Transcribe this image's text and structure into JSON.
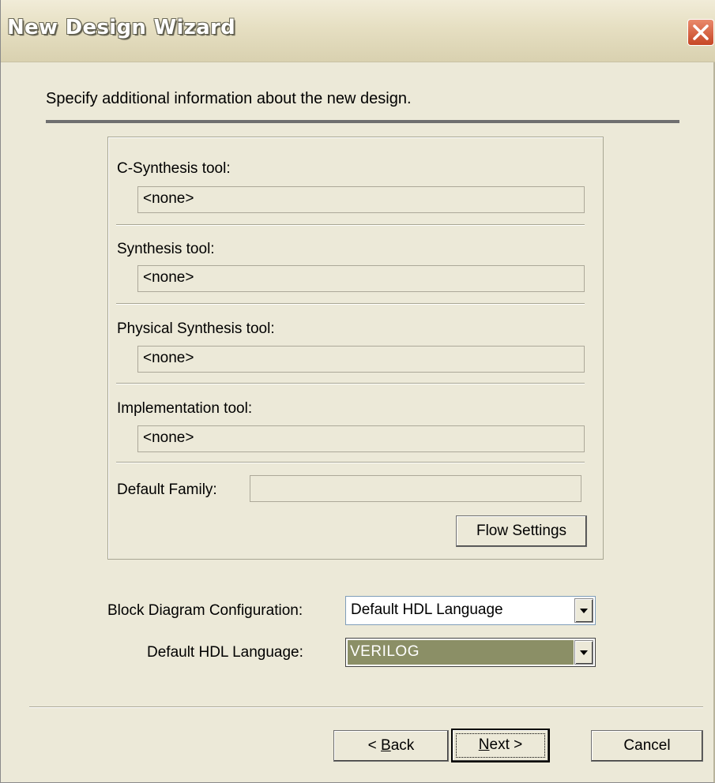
{
  "window": {
    "title": "New Design Wizard"
  },
  "instruction": "Specify additional information about the new design.",
  "tools": {
    "c_synthesis_label": "C-Synthesis tool:",
    "c_synthesis_value": "<none>",
    "synthesis_label": "Synthesis tool:",
    "synthesis_value": "<none>",
    "physical_synthesis_label": "Physical Synthesis tool:",
    "physical_synthesis_value": "<none>",
    "implementation_label": "Implementation tool:",
    "implementation_value": "<none>",
    "default_family_label": "Default Family:",
    "default_family_value": "",
    "flow_settings_label": "Flow Settings"
  },
  "block_diagram": {
    "label": "Block Diagram Configuration:",
    "selected": "Default HDL Language"
  },
  "hdl_language": {
    "label": "Default HDL Language:",
    "selected": "VERILOG"
  },
  "buttons": {
    "back_prefix": "< ",
    "back_key": "B",
    "back_rest": "ack",
    "next_key": "N",
    "next_rest": "ext >",
    "cancel": "Cancel"
  },
  "colors": {
    "dialog_bg": "#ece9d8",
    "selection_bg": "#8b8f66",
    "close_button": "#c64624"
  }
}
